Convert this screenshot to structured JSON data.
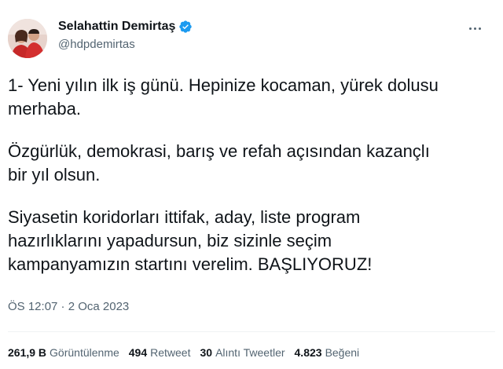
{
  "colors": {
    "text_primary": "#0f1419",
    "text_secondary": "#536471",
    "verified_badge": "#1d9bf0",
    "divider": "#eff3f4"
  },
  "author": {
    "name": "Selahattin Demirtaş",
    "handle": "@hdpdemirtas",
    "verified_icon": "verified-badge-icon",
    "avatar_icon": "profile-avatar"
  },
  "menu": {
    "icon": "more-options-icon"
  },
  "tweet": {
    "paragraphs": [
      {
        "lines": [
          "1- Yeni yılın ilk iş günü. Hepinize kocaman, yürek dolusu",
          "merhaba."
        ]
      },
      {
        "lines": [
          "Özgürlük, demokrasi, barış ve refah açısından kazançlı",
          "bir yıl olsun."
        ]
      },
      {
        "lines": [
          "Siyasetin koridorları ittifak, aday, liste program",
          "hazırlıklarını yapadursun, biz sizinle seçim",
          "kampanyamızın startını verelim. BAŞLIYORUZ!"
        ]
      }
    ],
    "timestamp": "ÖS 12:07 · 2 Oca 2023"
  },
  "stats": {
    "views": {
      "value": "261,9 B",
      "label": "Görüntülenme"
    },
    "retweets": {
      "value": "494",
      "label": "Retweet"
    },
    "quotes": {
      "value": "30",
      "label": "Alıntı Tweetler"
    },
    "likes": {
      "value": "4.823",
      "label": "Beğeni"
    }
  }
}
